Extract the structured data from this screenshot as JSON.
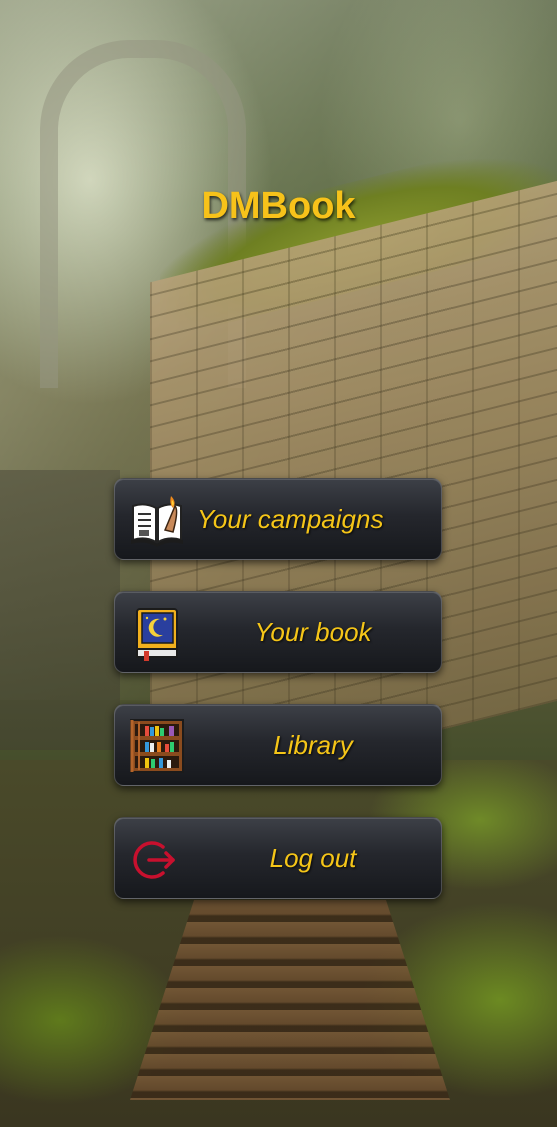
{
  "app": {
    "title": "DMBook"
  },
  "menu": {
    "items": [
      {
        "label": "Your campaigns",
        "icon": "open-book-quill-icon"
      },
      {
        "label": "Your book",
        "icon": "moon-book-icon"
      },
      {
        "label": "Library",
        "icon": "bookshelf-icon"
      },
      {
        "label": "Log out",
        "icon": "logout-icon"
      }
    ]
  },
  "colors": {
    "title": "#f7c21a",
    "button_text": "#f5c518",
    "button_bg": "#25272d",
    "logout_icon": "#c8102e"
  }
}
